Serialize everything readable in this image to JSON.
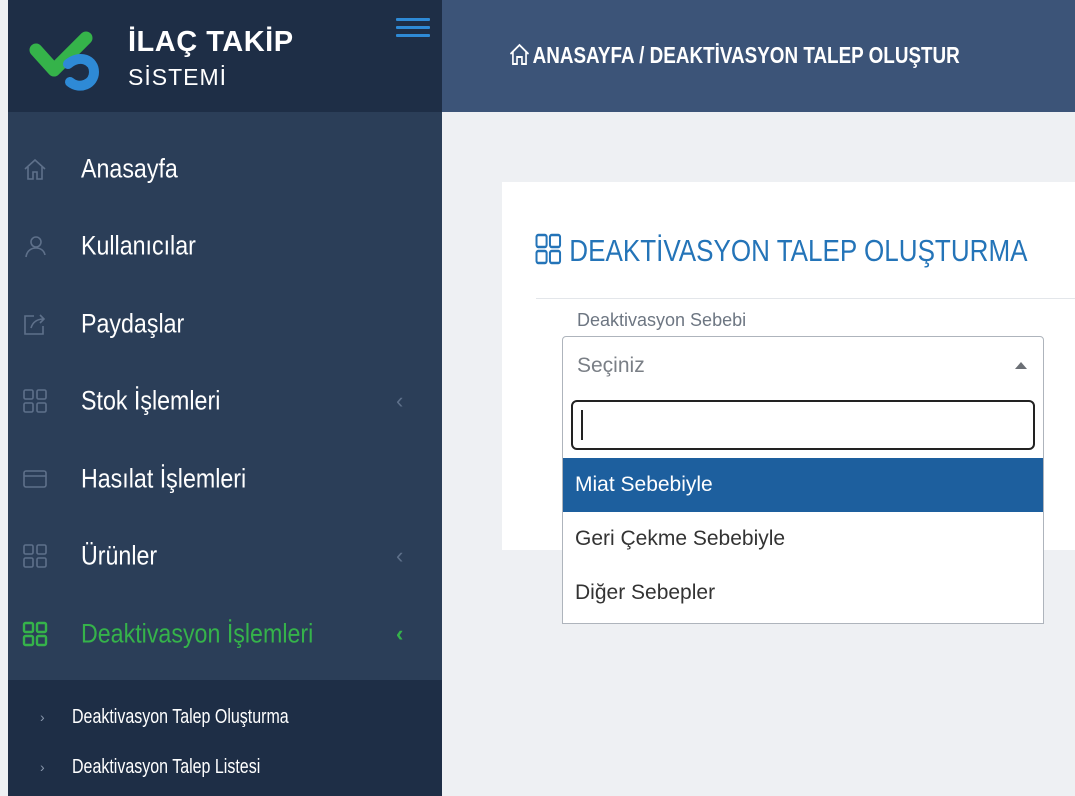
{
  "brand": {
    "title": "İLAÇ TAKİP",
    "subtitle": "SİSTEMİ"
  },
  "header": {
    "breadcrumb_home": "ANASAYFA",
    "breadcrumb_sep": " / ",
    "breadcrumb_current": "DEAKTİVASYON TALEP OLUŞTUR"
  },
  "sidebar": {
    "items": [
      {
        "label": "Anasayfa",
        "icon": "home-icon"
      },
      {
        "label": "Kullanıcılar",
        "icon": "users-icon"
      },
      {
        "label": "Paydaşlar",
        "icon": "share-icon"
      },
      {
        "label": "Stok İşlemleri",
        "icon": "grid-icon",
        "chevron": "‹"
      },
      {
        "label": "Hasılat İşlemleri",
        "icon": "card-icon"
      },
      {
        "label": "Ürünler",
        "icon": "grid-icon",
        "chevron": "‹"
      },
      {
        "label": "Deaktivasyon İşlemleri",
        "icon": "grid-icon",
        "chevron": "‹",
        "active": true
      }
    ],
    "subitems": [
      {
        "label": "Deaktivasyon Talep Oluşturma",
        "bullet": "›"
      },
      {
        "label": "Deaktivasyon Talep Listesi",
        "bullet": "›"
      }
    ]
  },
  "card": {
    "title": "DEAKTİVASYON TALEP OLUŞTURMA",
    "field_label": "Deaktivasyon Sebebi",
    "select_value": "Seçiniz",
    "search_value": "",
    "options": [
      "Miat Sebebiyle",
      "Geri Çekme Sebebiyle",
      "Diğer Sebepler"
    ],
    "selected_option": "Miat Sebebiyle"
  },
  "colors": {
    "sidebar_bg": "#2b3e58",
    "brand_bg": "#1e2e46",
    "header_bg": "#3c5478",
    "active_green": "#35b34a",
    "title_blue": "#2474b8",
    "option_highlight": "#1d5f9e"
  }
}
